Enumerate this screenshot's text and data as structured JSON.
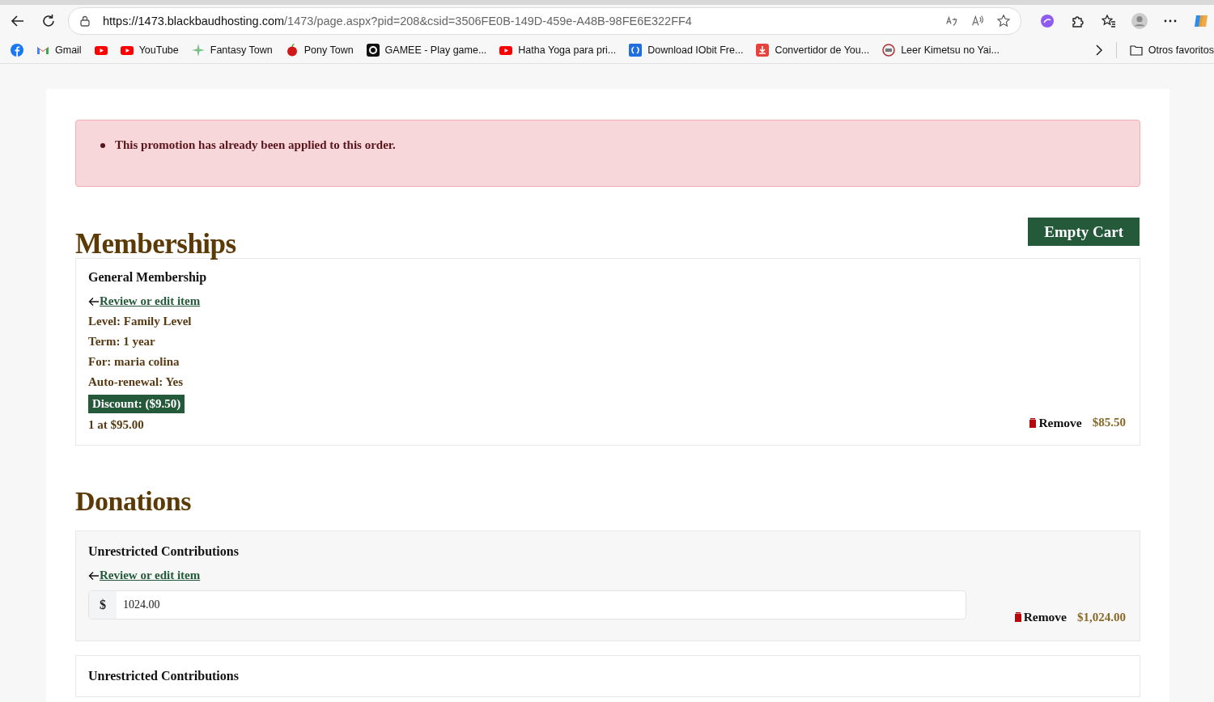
{
  "browser": {
    "url_host": "https://1473.blackbaudhosting.com",
    "url_path": "/1473/page.aspx?pid=208&csid=3506FE0B-149D-459e-A48B-98FE6E322FF4",
    "bookmarks": [
      {
        "kind": "facebook"
      },
      {
        "kind": "gmail",
        "label": "Gmail"
      },
      {
        "kind": "youtube"
      },
      {
        "kind": "youtube",
        "label": "YouTube"
      },
      {
        "kind": "sparkle",
        "label": "Fantasy Town"
      },
      {
        "kind": "apple",
        "label": "Pony Town"
      },
      {
        "kind": "gamee",
        "label": "GAMEE - Play game..."
      },
      {
        "kind": "youtube",
        "label": "Hatha Yoga para pri..."
      },
      {
        "kind": "iobit",
        "label": "Download IObit Fre..."
      },
      {
        "kind": "download",
        "label": "Convertidor de You..."
      },
      {
        "kind": "badge",
        "label": "Leer Kimetsu no Yai..."
      }
    ],
    "other_favorites": "Otros favoritos"
  },
  "alert": {
    "messages": [
      "This promotion has already been applied to this order."
    ]
  },
  "memberships": {
    "heading": "Memberships",
    "empty_cart": "Empty Cart",
    "item": {
      "title": "General Membership",
      "link": "Review or edit item",
      "details": [
        "Level: Family Level",
        "Term: 1 year",
        "For: maria colina",
        "Auto-renewal: Yes"
      ],
      "discount": "Discount: ($9.50)",
      "quantity": "1 at  $95.00",
      "remove": "Remove",
      "price": "$85.50"
    }
  },
  "donations": {
    "heading": "Donations",
    "items": [
      {
        "title": "Unrestricted Contributions",
        "highlighted": true,
        "link": "Review or edit item",
        "currency": "$",
        "amount": "1024.00",
        "remove": "Remove",
        "price": "$1,024.00"
      },
      {
        "title": "Unrestricted Contributions",
        "highlighted": false
      }
    ]
  }
}
